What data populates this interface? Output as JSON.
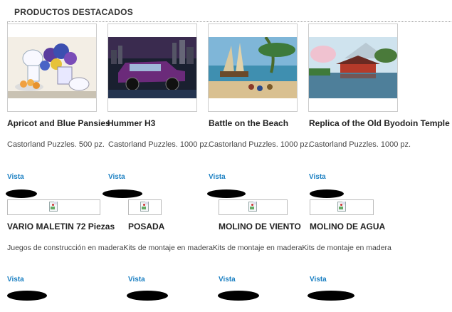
{
  "section": {
    "title": "PRODUCTOS DESTACADOS"
  },
  "products_row1": [
    {
      "name": "Apricot and Blue Pansies",
      "desc": "Castorland Puzzles. 500 pz.",
      "link": "Vista"
    },
    {
      "name": "Hummer H3",
      "desc": "Castorland Puzzles. 1000 pz.",
      "link": "Vista"
    },
    {
      "name": "Battle on the Beach",
      "desc": "Castorland Puzzles. 1000 pz.",
      "link": "Vista"
    },
    {
      "name": "Replica of the Old Byodoin Temple",
      "desc": "Castorland Puzzles. 1000 pz.",
      "link": "Vista"
    }
  ],
  "products_row2": [
    {
      "name": "VARIO MALETIN 72 Piezas",
      "link": "Vista"
    },
    {
      "name": "POSADA",
      "link": "Vista"
    },
    {
      "name": "MOLINO DE VIENTO",
      "link": "Vista"
    },
    {
      "name": "MOLINO DE AGUA",
      "link": "Vista"
    }
  ],
  "row2_desc": "Juegos de construcción en maderaKits de montaje en maderaKits de montaje en maderaKits de montaje en madera",
  "colors": {
    "link": "#1a7fc2",
    "border": "#cccccc"
  },
  "icons": {
    "broken_image": "broken-image-icon"
  }
}
